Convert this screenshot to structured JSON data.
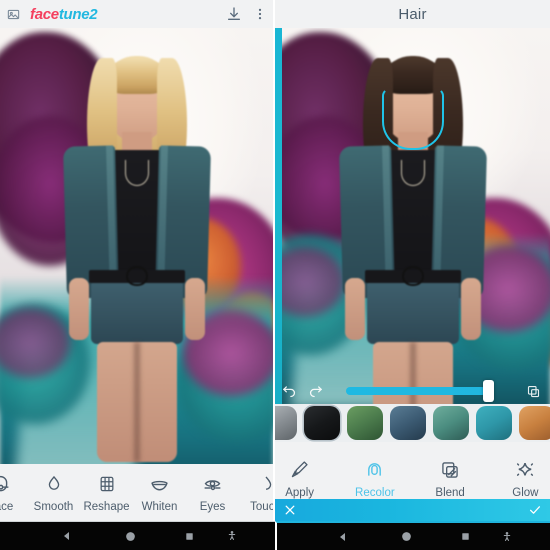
{
  "app": {
    "name": "facetune2",
    "name_part_red": "face",
    "name_part_blue": "tune2",
    "gallery_icon": "photo-icon",
    "download_icon": "download-icon",
    "overflow_icon": "more-vertical-icon"
  },
  "left_panel": {
    "header": {
      "logo_red": "face",
      "logo_blue": "tune2",
      "save_label": "download",
      "menu_label": "more options"
    },
    "photo": {
      "subject": "woman with blonde hair in denim jacket",
      "hair_color": "#e0c183"
    },
    "toolbar": {
      "items": [
        {
          "label": "Face",
          "icon": "face-icon",
          "active": false,
          "clipped": true
        },
        {
          "label": "Smooth",
          "icon": "droplet-icon",
          "active": false,
          "clipped": false
        },
        {
          "label": "Reshape",
          "icon": "grid-icon",
          "active": false,
          "clipped": false
        },
        {
          "label": "Whiten",
          "icon": "teeth-icon",
          "active": false,
          "clipped": false
        },
        {
          "label": "Eyes",
          "icon": "eye-icon",
          "active": false,
          "clipped": false
        },
        {
          "label": "Touch",
          "icon": "touchup-icon",
          "active": false,
          "clipped": true
        }
      ]
    }
  },
  "right_panel": {
    "header": {
      "title": "Hair"
    },
    "photo": {
      "subject": "woman with dark brown hair in denim jacket",
      "hair_color": "#3a2920",
      "selection_overlay": "face-outline"
    },
    "edit_bar": {
      "undo_icon": "undo-icon",
      "redo_icon": "redo-icon",
      "compare_icon": "compare-icon",
      "slider_value": 88
    },
    "swatches": [
      {
        "name": "gray",
        "color": "#8d9398",
        "selected": false
      },
      {
        "name": "black",
        "color": "#16181a",
        "selected": true
      },
      {
        "name": "green",
        "color": "#4b7b4c",
        "selected": false
      },
      {
        "name": "navy",
        "color": "#3c5b73",
        "selected": false
      },
      {
        "name": "sea-green",
        "color": "#4b8d80",
        "selected": false
      },
      {
        "name": "teal",
        "color": "#2e97a8",
        "selected": false
      },
      {
        "name": "copper",
        "color": "#c8803f",
        "selected": false
      }
    ],
    "toolbar": {
      "items": [
        {
          "label": "Apply",
          "icon": "brush-icon",
          "active": false
        },
        {
          "label": "Recolor",
          "icon": "hair-icon",
          "active": true
        },
        {
          "label": "Blend",
          "icon": "blend-icon",
          "active": false
        },
        {
          "label": "Glow",
          "icon": "sparkle-icon",
          "active": false
        }
      ]
    },
    "confirm_bar": {
      "cancel_icon": "close-icon",
      "accept_icon": "check-icon",
      "background": "#1ab6df"
    }
  },
  "navbar": {
    "buttons": [
      {
        "name": "back",
        "icon": "triangle-left-icon"
      },
      {
        "name": "home",
        "icon": "circle-icon"
      },
      {
        "name": "recents",
        "icon": "square-icon"
      },
      {
        "name": "accessibility",
        "icon": "person-icon"
      }
    ]
  },
  "colors": {
    "accent_cyan": "#1ab6df",
    "logo_red": "#f43f5e",
    "logo_blue": "#22b8e0",
    "panel_bg": "#f1f2f3",
    "text": "#4d5d6c"
  }
}
